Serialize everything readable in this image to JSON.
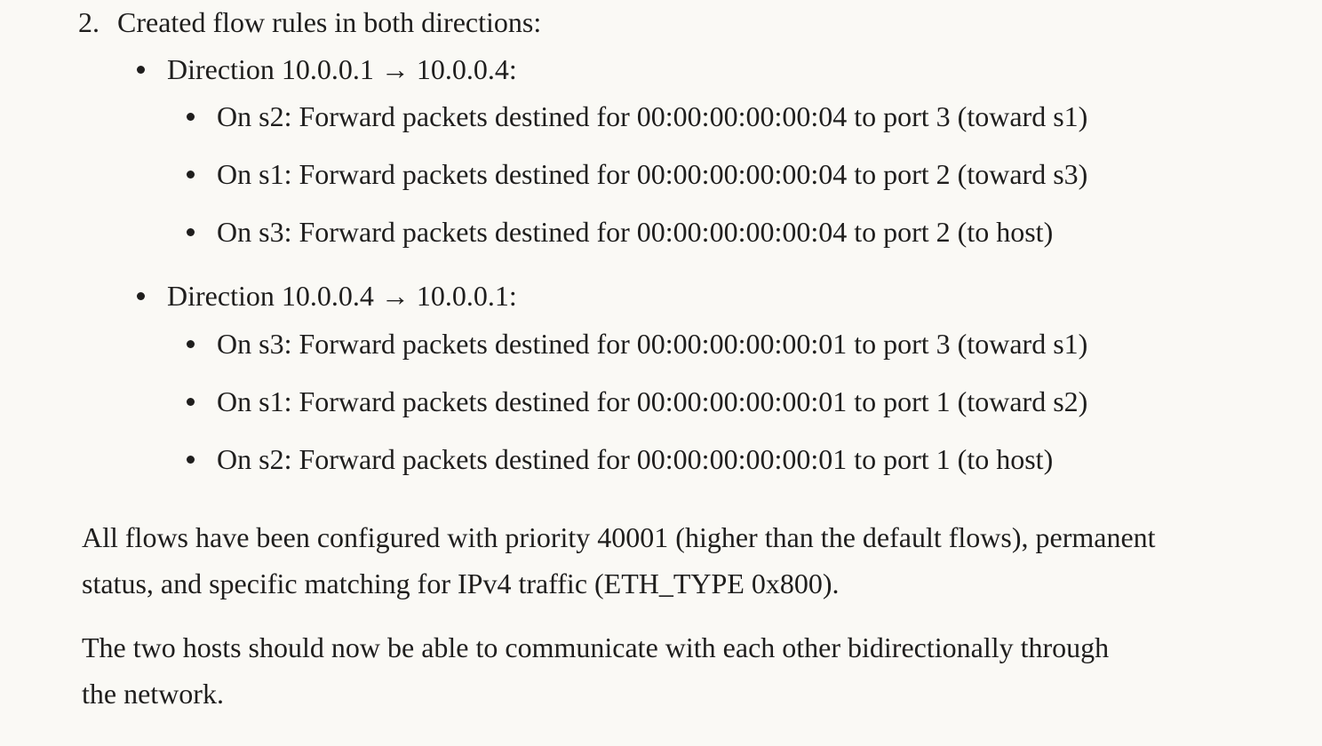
{
  "list": {
    "number": "2.",
    "title": "Created flow rules in both directions:",
    "directions": [
      {
        "label": "Direction 10.0.0.1 → 10.0.0.4:",
        "rules": [
          "On s2: Forward packets destined for 00:00:00:00:00:04 to port 3 (toward s1)",
          "On s1: Forward packets destined for 00:00:00:00:00:04 to port 2 (toward s3)",
          "On s3: Forward packets destined for 00:00:00:00:00:04 to port 2 (to host)"
        ]
      },
      {
        "label": "Direction 10.0.0.4 → 10.0.0.1:",
        "rules": [
          "On s3: Forward packets destined for 00:00:00:00:00:01 to port 3 (toward s1)",
          "On s1: Forward packets destined for 00:00:00:00:00:01 to port 1 (toward s2)",
          "On s2: Forward packets destined for 00:00:00:00:00:01 to port 1 (to host)"
        ]
      }
    ]
  },
  "paragraphs": [
    [
      "All flows have been configured with priority 40001 (higher than the default flows), permanent",
      "status, and specific matching for IPv4 traffic (ETH_TYPE 0x800)."
    ],
    [
      "The two hosts should now be able to communicate with each other bidirectionally through",
      "the network."
    ]
  ]
}
